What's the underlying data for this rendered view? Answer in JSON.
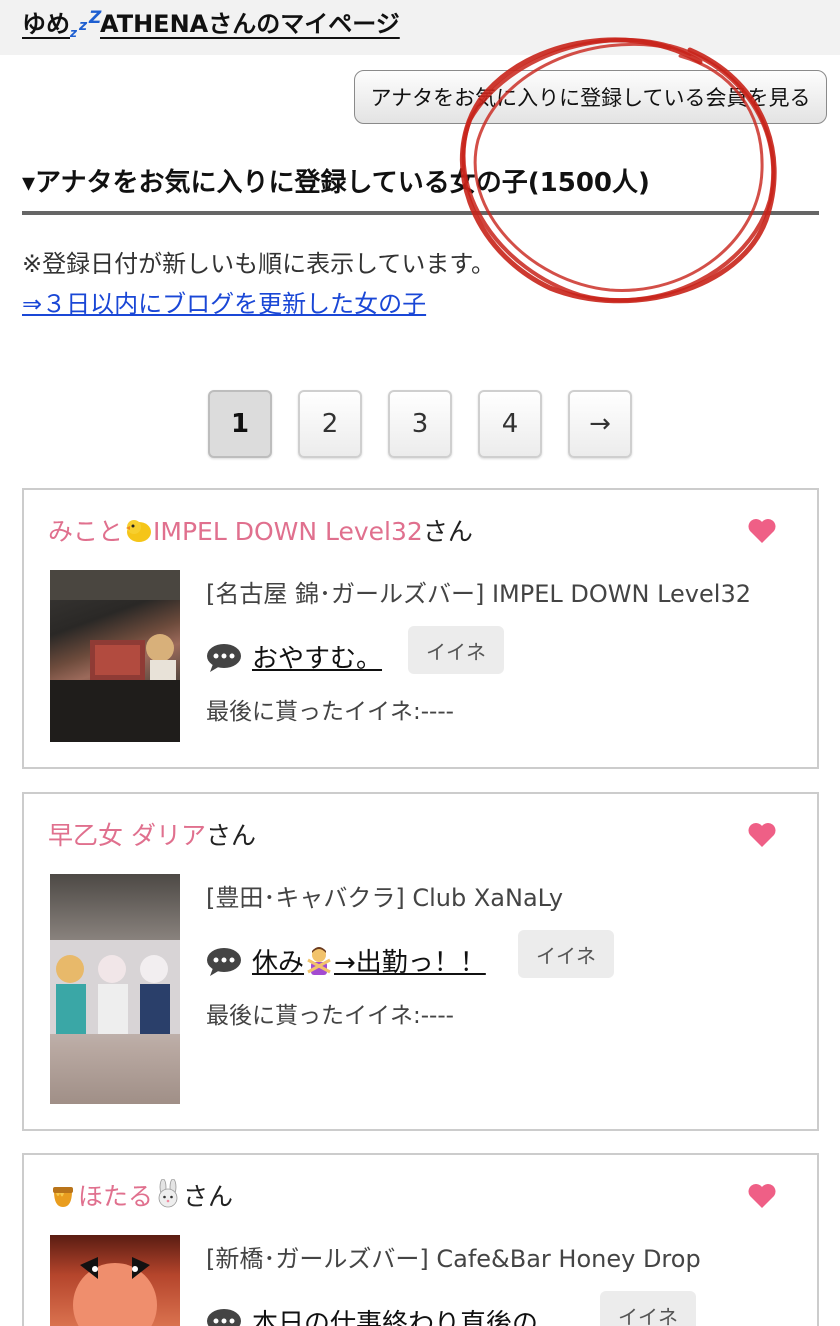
{
  "header": {
    "title_prefix": "ゆめ",
    "title_suffix": "ATHENAさんのマイページ",
    "zz_small": "z",
    "zz_mid": "z",
    "zz_big": "Z"
  },
  "members_button_label": "アナタをお気に入りに登録している会員を見る",
  "section": {
    "heading": "▾アナタをお気に入りに登録している女の子(1500人)",
    "note": "※登録日付が新しいも順に表示しています。",
    "blog_link": "⇒３日以内にブログを更新した女の子"
  },
  "pagination": {
    "pages": [
      "1",
      "2",
      "3",
      "4"
    ],
    "next": "→",
    "current": "1"
  },
  "cards": [
    {
      "name_part1": "みこと",
      "name_part2": "IMPEL DOWN Level32",
      "san": "さん",
      "shop": "[名古屋 錦･ガールズバー] IMPEL DOWN Level32",
      "post": "おやすむ。",
      "like_label": "イイネ",
      "last_like": "最後に貰ったイイネ:----"
    },
    {
      "name_part1": "早乙女 ダリア",
      "san": "さん",
      "shop": "[豊田･キャバクラ] Club XaNaLy",
      "post_part1": "休み",
      "post_part2": "→出勤っ！！",
      "like_label": "イイネ",
      "last_like": "最後に貰ったイイネ:----"
    },
    {
      "name_part1": "ほたる",
      "san": "さん",
      "shop": "[新橋･ガールズバー] Cafe&Bar Honey Drop",
      "post": "本日の仕事終わり直後の",
      "like_label": "イイネ"
    }
  ],
  "colors": {
    "name_pink": "#e0708e",
    "heart_pink": "#ef5f86",
    "link_blue": "#1a47d6",
    "annotation_red": "#c8231a"
  },
  "icons": [
    "heart-icon",
    "speech-bubble-icon",
    "chick-emoji",
    "person-gesturing-no-emoji",
    "honey-pot-emoji",
    "rabbit-emoji"
  ]
}
